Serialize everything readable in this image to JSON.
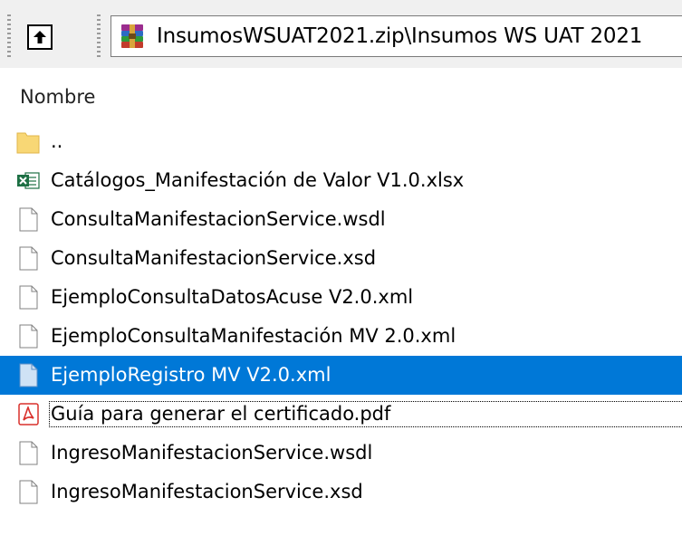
{
  "address_bar": {
    "path": "InsumosWSUAT2021.zip\\Insumos WS UAT 2021"
  },
  "columns": {
    "name": "Nombre"
  },
  "files": [
    {
      "name": "..",
      "icon": "folder-icon"
    },
    {
      "name": "Catálogos_Manifestación de Valor V1.0.xlsx",
      "icon": "excel-icon"
    },
    {
      "name": "ConsultaManifestacionService.wsdl",
      "icon": "file-icon"
    },
    {
      "name": "ConsultaManifestacionService.xsd",
      "icon": "file-icon"
    },
    {
      "name": "EjemploConsultaDatosAcuse V2.0.xml",
      "icon": "file-icon"
    },
    {
      "name": "EjemploConsultaManifestación MV 2.0.xml",
      "icon": "file-icon"
    },
    {
      "name": "EjemploRegistro MV V2.0.xml",
      "icon": "file-icon",
      "selected": true
    },
    {
      "name": "Guía para generar el certificado.pdf",
      "icon": "pdf-icon",
      "focused": true
    },
    {
      "name": "IngresoManifestacionService.wsdl",
      "icon": "file-icon"
    },
    {
      "name": "IngresoManifestacionService.xsd",
      "icon": "file-icon"
    }
  ],
  "colors": {
    "selection": "#0078d7",
    "folder": "#f8d775",
    "excel": "#1d7044",
    "pdf": "#d9302c"
  }
}
